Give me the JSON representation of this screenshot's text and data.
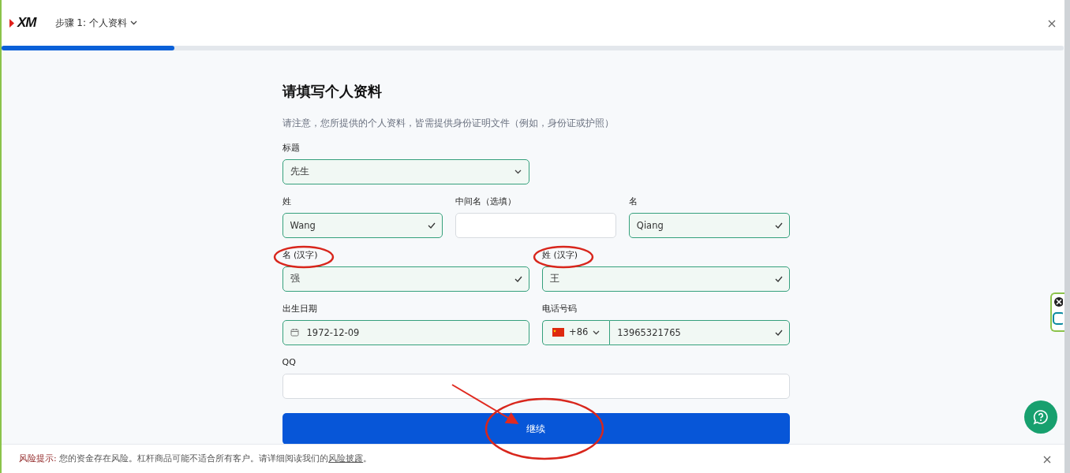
{
  "header": {
    "logo": "XM",
    "step": "步骤 1: 个人资料"
  },
  "progress": {
    "level": 0.163
  },
  "form": {
    "title": "请填写个人资料",
    "note": "请注意，您所提供的个人资料，皆需提供身份证明文件（例如，身份证或护照）",
    "rows": [
      [
        {
          "kind": "select",
          "label": "标题",
          "value": "先生",
          "valid": true,
          "half": true
        }
      ],
      [
        {
          "kind": "text",
          "label": "姓",
          "value": "Wang",
          "valid": true
        },
        {
          "kind": "text",
          "label": "中间名（选填）",
          "valid": false
        },
        {
          "kind": "text",
          "label": "名",
          "value": "Qiang",
          "valid": true
        }
      ],
      [
        {
          "kind": "text",
          "label": "名 (汉字)",
          "value": "强",
          "valid": true
        },
        {
          "kind": "text",
          "label": "姓 (汉字)",
          "value": "王",
          "valid": true
        }
      ],
      [
        {
          "kind": "date",
          "label": "出生日期",
          "value": "1972-12-09",
          "valid": true
        },
        {
          "kind": "phone",
          "label": "电话号码",
          "code": "+86",
          "value": "13965321765",
          "valid": true
        }
      ],
      [
        {
          "kind": "text",
          "label": "QQ",
          "valid": false
        }
      ]
    ],
    "submit": "继续"
  },
  "footer": {
    "prefix": "风险提示:",
    "text": " 您的资金存在风险。杠杆商品可能不适合所有客户。请详细阅读我们的",
    "link": "风险披露",
    "suffix": "。"
  }
}
